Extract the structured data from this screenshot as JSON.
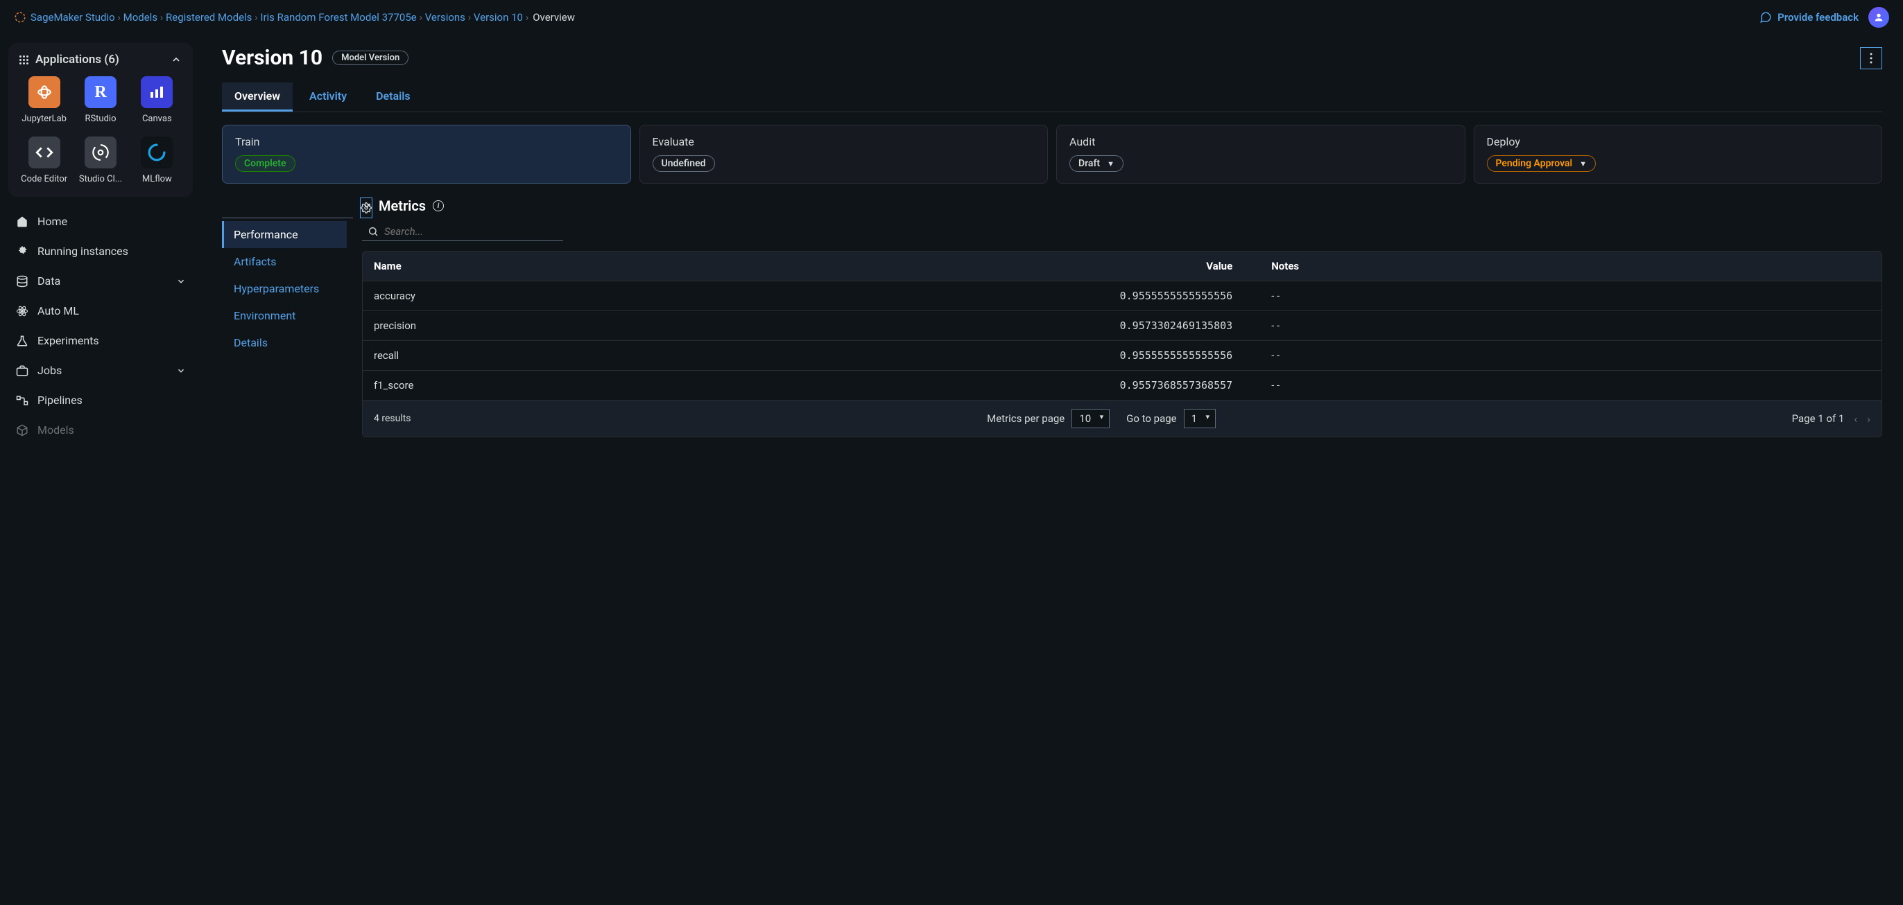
{
  "breadcrumbs": {
    "items": [
      "SageMaker Studio",
      "Models",
      "Registered Models",
      "Iris Random Forest Model 37705e",
      "Versions",
      "Version 10"
    ],
    "current": "Overview"
  },
  "feedback_label": "Provide feedback",
  "sidebar": {
    "apps_header": "Applications (6)",
    "apps": [
      {
        "label": "JupyterLab",
        "bg": "#e07b3a"
      },
      {
        "label": "RStudio",
        "bg": "#4b6cfb"
      },
      {
        "label": "Canvas",
        "bg": "#3a3fd9"
      },
      {
        "label": "Code Editor",
        "bg": "#3a3f47"
      },
      {
        "label": "Studio Cl...",
        "bg": "#3a3f47"
      },
      {
        "label": "MLflow",
        "bg": "#0f1419"
      }
    ],
    "nav": [
      {
        "label": "Home",
        "icon": "home",
        "chev": false
      },
      {
        "label": "Running instances",
        "icon": "gear",
        "chev": false
      },
      {
        "label": "Data",
        "icon": "stack",
        "chev": true
      },
      {
        "label": "Auto ML",
        "icon": "atom",
        "chev": false
      },
      {
        "label": "Experiments",
        "icon": "flask",
        "chev": false
      },
      {
        "label": "Jobs",
        "icon": "briefcase",
        "chev": true
      },
      {
        "label": "Pipelines",
        "icon": "pipeline",
        "chev": false
      },
      {
        "label": "Models",
        "icon": "cube",
        "chev": false,
        "dim": true
      }
    ]
  },
  "page": {
    "title": "Version 10",
    "badge": "Model Version",
    "tabs": [
      "Overview",
      "Activity",
      "Details"
    ],
    "active_tab": 0
  },
  "stages": [
    {
      "title": "Train",
      "status": "Complete",
      "style": "green",
      "dropdown": false,
      "active": true
    },
    {
      "title": "Evaluate",
      "status": "Undefined",
      "style": "plain",
      "dropdown": false,
      "active": false
    },
    {
      "title": "Audit",
      "status": "Draft",
      "style": "plain",
      "dropdown": true,
      "active": false
    },
    {
      "title": "Deploy",
      "status": "Pending Approval",
      "style": "orange",
      "dropdown": true,
      "active": false
    }
  ],
  "sidenav": {
    "items": [
      "Performance",
      "Artifacts",
      "Hyperparameters",
      "Environment",
      "Details"
    ],
    "active": 0
  },
  "metrics": {
    "section_title": "Metrics",
    "search_placeholder": "Search...",
    "columns": {
      "name": "Name",
      "value": "Value",
      "notes": "Notes"
    },
    "rows": [
      {
        "name": "accuracy",
        "value": "0.9555555555555556",
        "notes": "- -"
      },
      {
        "name": "precision",
        "value": "0.9573302469135803",
        "notes": "- -"
      },
      {
        "name": "recall",
        "value": "0.9555555555555556",
        "notes": "- -"
      },
      {
        "name": "f1_score",
        "value": "0.9557368557368557",
        "notes": "- -"
      }
    ],
    "footer": {
      "results": "4 results",
      "per_page_label": "Metrics per page",
      "per_page_value": "10",
      "goto_label": "Go to page",
      "goto_value": "1",
      "page_text": "Page 1 of 1"
    }
  }
}
